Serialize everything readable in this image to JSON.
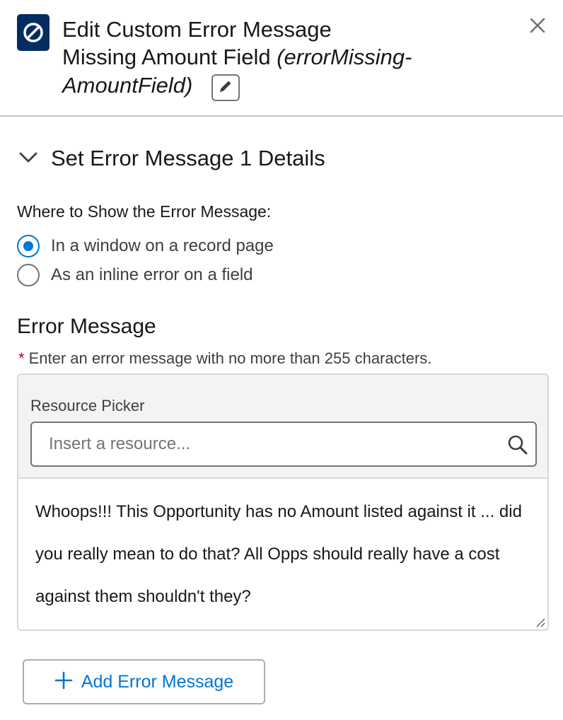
{
  "header": {
    "icon": "block-icon",
    "title_line1": "Edit Custom Error Message",
    "title_name": "Missing Amount Field ",
    "title_api_part1": "(errorMissing-",
    "title_api_part2": "AmountField)",
    "edit_icon": "pencil-icon",
    "close_icon": "close-icon"
  },
  "section": {
    "chevron_icon": "chevron-down-icon",
    "title": "Set Error Message 1 Details"
  },
  "where": {
    "label": "Where to Show the Error Message:",
    "options": [
      {
        "label": "In a window on a record page",
        "checked": true
      },
      {
        "label": "As an inline error on a field",
        "checked": false
      }
    ]
  },
  "error_message": {
    "heading": "Error Message",
    "required_marker": "*",
    "instruction": "Enter an error message with no more than 255 characters.",
    "resource_picker_label": "Resource Picker",
    "resource_picker_placeholder": "Insert a resource...",
    "resource_picker_icon": "search-icon",
    "message_text": "Whoops!!! This Opportunity has no Amount listed against it ... did you really mean to do that? All Opps should really have a cost against them shouldn't they?"
  },
  "add_button": {
    "icon": "plus-icon",
    "label": "Add Error Message"
  },
  "colors": {
    "brand_dark": "#032d60",
    "accent": "#0176d3",
    "required": "#ba0517"
  }
}
